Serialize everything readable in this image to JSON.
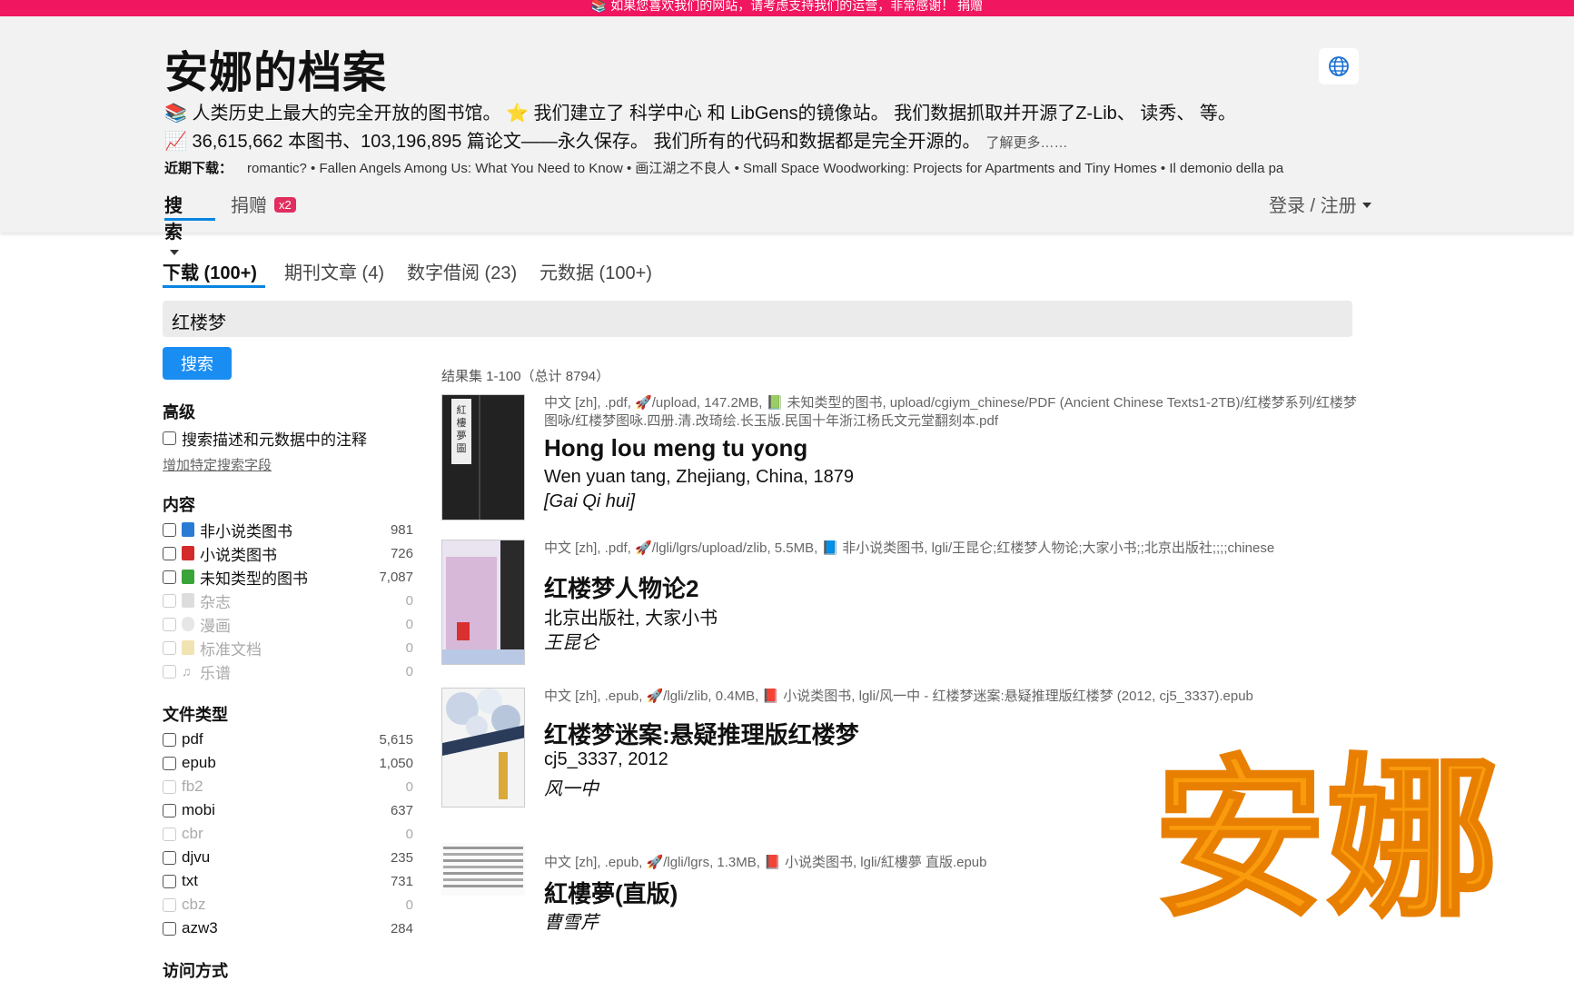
{
  "banner": {
    "text": "📚 如果您喜欢我们的网站，请考虑支持我们的运营，非常感谢！  捐赠"
  },
  "header": {
    "site_title": "安娜的档案",
    "tagline": "📚 人类历史上最大的完全开放的图书馆。 ⭐️ 我们建立了 科学中心 和 LibGens的镜像站。 我们数据抓取并开源了Z-Lib、 读秀、 等。",
    "stats": "📈 36,615,662 本图书、103,196,895 篇论文——永久保存。 我们所有的代码和数据都是完全开源的。",
    "learn_more": "了解更多……",
    "recent_label": "近期下载：",
    "recent_items": "romantic? • Fallen Angels Among Us: What You Need to Know • 画江湖之不良人 • Small Space Woodworking: Projects for Apartments and Tiny Homes • Il demonio della pa",
    "nav_search": "搜索",
    "nav_donate": "捐赠",
    "donate_badge": "x2",
    "login": "登录 / 注册",
    "globe_icon": "globe-icon"
  },
  "tabs": [
    {
      "label": "下载 (100+)",
      "active": true
    },
    {
      "label": "期刊文章 (4)"
    },
    {
      "label": "数字借阅 (23)"
    },
    {
      "label": "元数据 (100+)"
    }
  ],
  "search": {
    "value": "红楼梦",
    "button": "搜索"
  },
  "sidebar": {
    "advanced_title": "高级",
    "advanced_option": "搜索描述和元数据中的注释",
    "add_field_link": "增加特定搜索字段",
    "content_title": "内容",
    "content": [
      {
        "label": "非小说类图书",
        "count": "981"
      },
      {
        "label": "小说类图书",
        "count": "726"
      },
      {
        "label": "未知类型的图书",
        "count": "7,087"
      },
      {
        "label": "杂志",
        "count": "0"
      },
      {
        "label": "漫画",
        "count": "0"
      },
      {
        "label": "标准文档",
        "count": "0"
      },
      {
        "label": "乐谱",
        "count": "0"
      }
    ],
    "filetype_title": "文件类型",
    "filetypes": [
      {
        "label": "pdf",
        "count": "5,615"
      },
      {
        "label": "epub",
        "count": "1,050"
      },
      {
        "label": "fb2",
        "count": "0"
      },
      {
        "label": "mobi",
        "count": "637"
      },
      {
        "label": "cbr",
        "count": "0"
      },
      {
        "label": "djvu",
        "count": "235"
      },
      {
        "label": "txt",
        "count": "731"
      },
      {
        "label": "cbz",
        "count": "0"
      },
      {
        "label": "azw3",
        "count": "284"
      }
    ],
    "access_title": "访问方式"
  },
  "results": {
    "summary": "结果集 1-100（总计 8794）",
    "items": [
      {
        "meta": "中文 [zh], .pdf, 🚀/upload, 147.2MB, 📗 未知类型的图书, upload/cgiym_chinese/PDF (Ancient Chinese Texts1-2TB)/红楼梦系列/红楼梦图咏/红楼梦图咏.四册.清.改琦绘.长玉版.民国十年浙江杨氏文元堂翻刻本.pdf",
        "title": "Hong lou meng tu yong",
        "publisher": "Wen yuan tang, Zhejiang, China, 1879",
        "author": "[Gai Qi hui]"
      },
      {
        "meta": "中文 [zh], .pdf, 🚀/lgli/lgrs/upload/zlib, 5.5MB, 📘 非小说类图书, lgli/王昆仑;红楼梦人物论;大家小书;;北京出版社;;;;chinese",
        "title": "红楼梦人物论2",
        "publisher": "北京出版社, 大家小书",
        "author": "王昆仑"
      },
      {
        "meta": "中文 [zh], .epub, 🚀/lgli/zlib, 0.4MB, 📕 小说类图书, lgli/风一中 - 红楼梦迷案:悬疑推理版红楼梦 (2012, cj5_3337).epub",
        "title": "红楼梦迷案:悬疑推理版红楼梦",
        "publisher": "cj5_3337, 2012",
        "author": "风一中"
      },
      {
        "meta": "中文 [zh], .epub, 🚀/lgli/lgrs, 1.3MB, 📕 小说类图书, lgli/紅樓夢 直版.epub",
        "title": "紅樓夢(直版)",
        "author": "曹雪芹"
      }
    ]
  },
  "watermark": {
    "text": "安娜"
  },
  "colors": {
    "banner": "#f0165f",
    "accent": "#1a8df2",
    "badge": "#e02e5f",
    "watermark_fill": "#f99b0c"
  }
}
